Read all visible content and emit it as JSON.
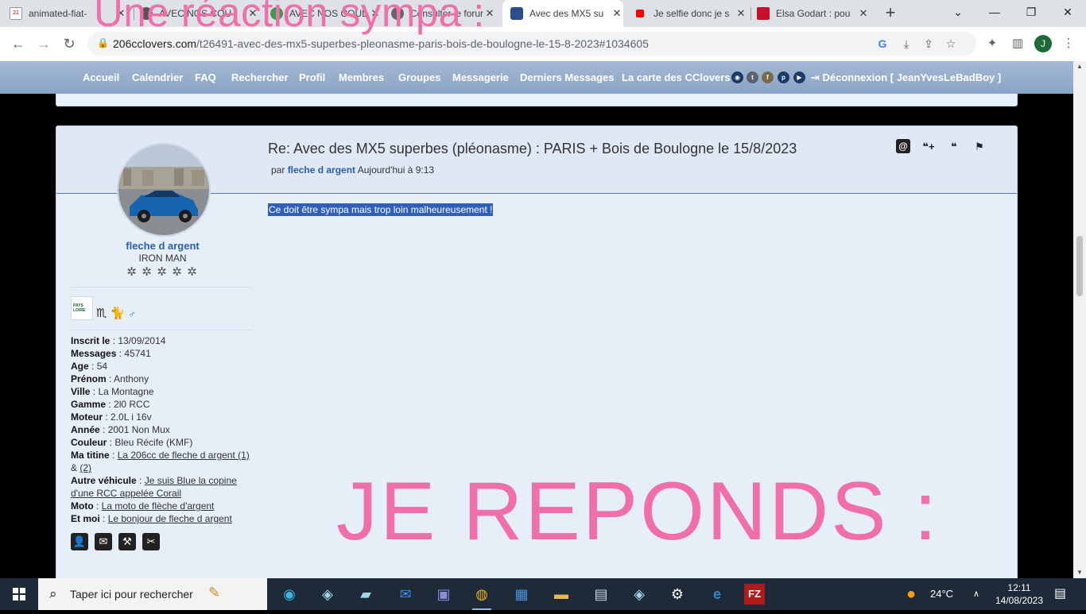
{
  "browser": {
    "tabs": [
      {
        "title": "animated-fiat-",
        "active": false
      },
      {
        "title": "AVEC NOS COU",
        "active": false
      },
      {
        "title": "AVEC NOS COUL",
        "active": false
      },
      {
        "title": "Consulter le forum",
        "active": false
      },
      {
        "title": "Avec des MX5 su",
        "active": true
      },
      {
        "title": "Je selfie donc je s",
        "active": false
      },
      {
        "title": "Elsa Godart : pou",
        "active": false
      }
    ],
    "url_domain": "206cclovers.com",
    "url_path": "/t26491-avec-des-mx5-superbes-pleonasme-paris-bois-de-boulogne-le-15-8-2023#1034605",
    "profile_initial": "J"
  },
  "overlay": {
    "top_text": "Une réaction sympa :",
    "big_text": "JE REPONDS :"
  },
  "forum_nav": {
    "items": [
      "Accueil",
      "Calendrier",
      "FAQ",
      "Rechercher",
      "Profil",
      "Membres",
      "Groupes",
      "Messagerie",
      "Derniers Messages",
      "La carte des CClovers"
    ],
    "logout": "Déconnexion [ JeanYvesLeBadBoy ]"
  },
  "post": {
    "title": "Re: Avec des MX5 superbes (pléonasme)  : PARIS + Bois de Boulogne le 15/8/2023",
    "meta_prefix": "par",
    "author": "fleche d argent",
    "time": "Aujourd'hui à 9:13",
    "body": "Ce doit être sympa mais trop loin malheureusement !",
    "region_badge": "PAYS LOIRE"
  },
  "user": {
    "name": "fleche d argent",
    "rank": "IRON MAN",
    "fields": [
      {
        "label": "Inscrit le",
        "value": "13/09/2014"
      },
      {
        "label": "Messages",
        "value": "45741"
      },
      {
        "label": "Age",
        "value": "54"
      },
      {
        "label": "Prénom",
        "value": "Anthony"
      },
      {
        "label": "Ville",
        "value": "La Montagne"
      },
      {
        "label": "Gamme",
        "value": "2l0 RCC"
      },
      {
        "label": "Moteur",
        "value": "2.0L i 16v"
      },
      {
        "label": "Année",
        "value": "2001 Non Mux"
      },
      {
        "label": "Couleur",
        "value": "Bleu Récife (KMF)"
      }
    ],
    "titine_label": "Ma titine",
    "titine_link1": "La 206cc de fleche d argent (1)",
    "titine_amp": "&",
    "titine_link2": "(2)",
    "autre_label": "Autre véhicule",
    "autre_link": "Je suis Blue la copine d'une RCC appelée Corail",
    "moto_label": "Moto",
    "moto_link": "La moto de flèche d'argent",
    "etmoi_label": "Et moi",
    "etmoi_link": "Le bonjour de fleche d argent"
  },
  "taskbar": {
    "search_placeholder": "Taper ici pour rechercher",
    "temperature": "24°C",
    "time": "12:11",
    "date": "14/08/2023"
  },
  "colors": {
    "overlay_pink": "#f06eaa",
    "nav_blue": "#8ba4c4",
    "link_blue": "#2a5ea8"
  }
}
